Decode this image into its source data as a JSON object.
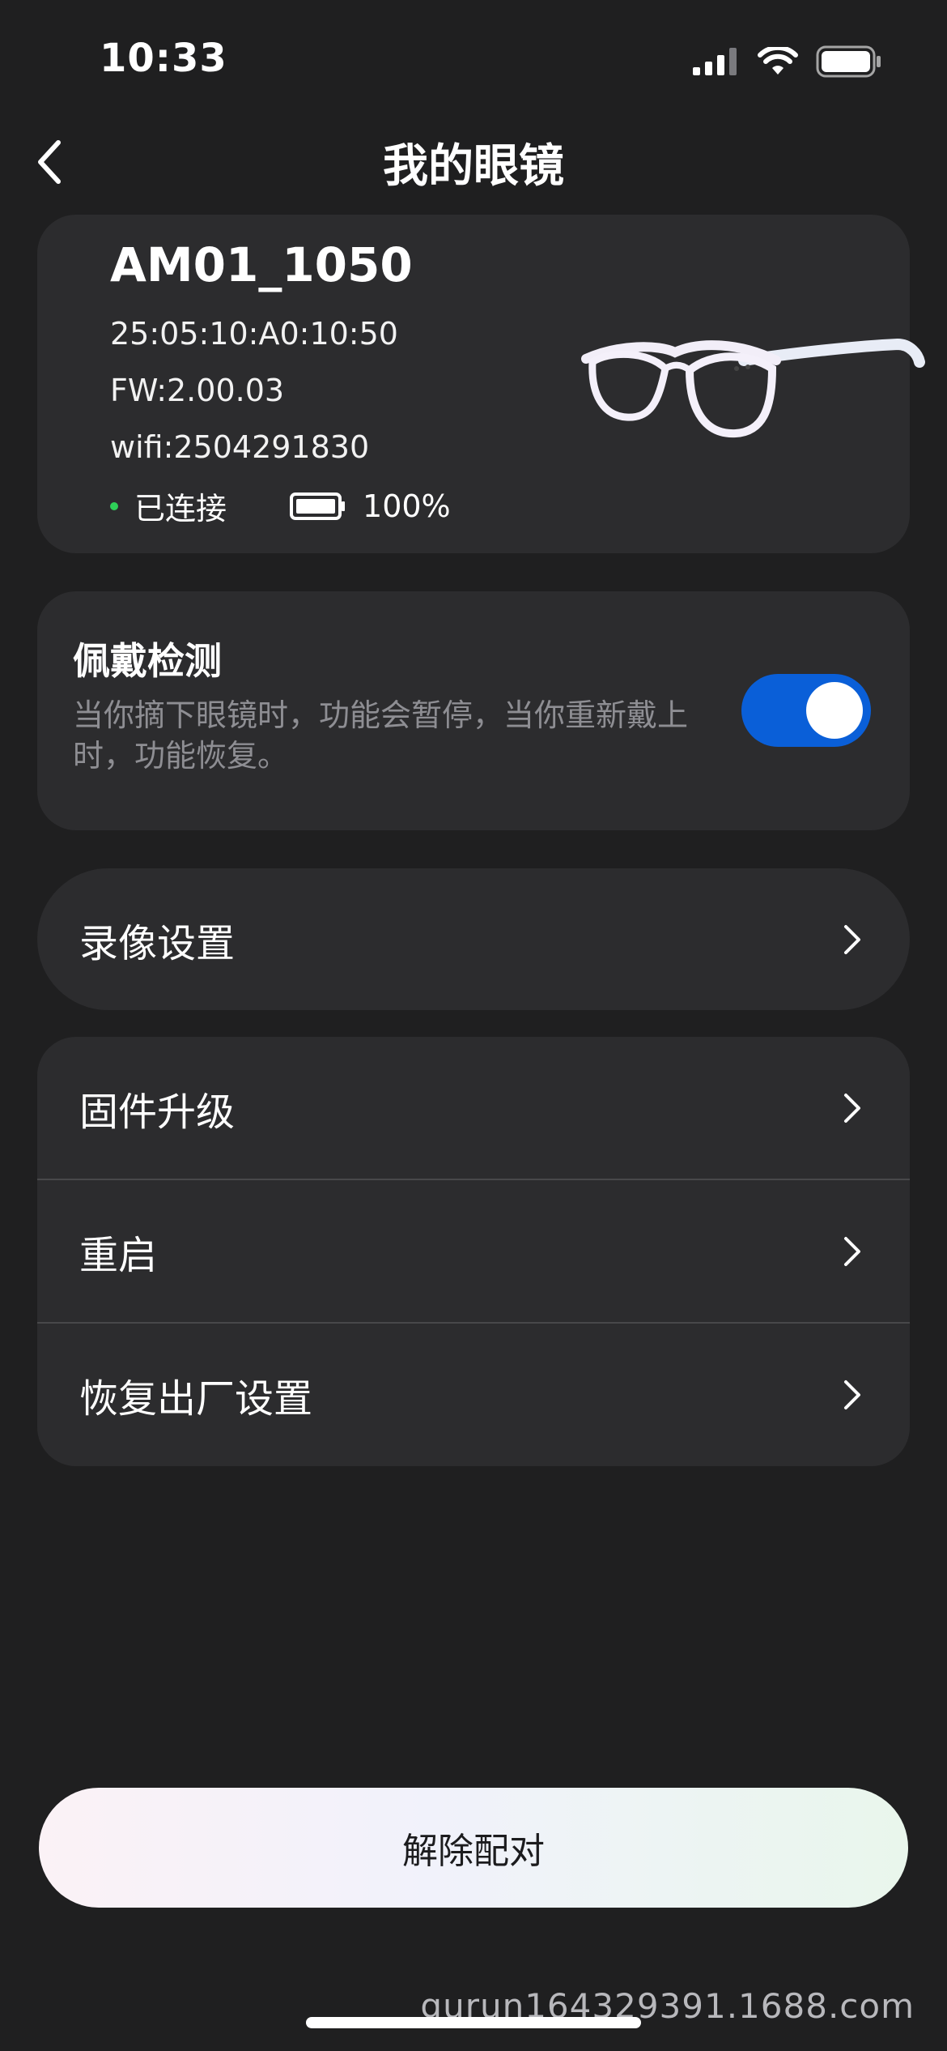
{
  "status_bar": {
    "time": "10:33",
    "icons": [
      "cellular-signal-icon",
      "wifi-icon",
      "battery-icon"
    ]
  },
  "nav": {
    "title": "我的眼镜",
    "back_icon": "chevron-left-icon"
  },
  "device": {
    "name": "AM01_1050",
    "mac": "25:05:10:A0:10:50",
    "firmware": "FW:2.00.03",
    "wifi": "wifi:2504291830",
    "connection_status": "已连接",
    "status_color": "#2ed158",
    "battery": "100%",
    "battery_level": 1.0,
    "image_icon": "glasses-icon"
  },
  "wear_detection": {
    "title": "佩戴检测",
    "description": "当你摘下眼镜时，功能会暂停，当你重新戴上时，功能恢复。",
    "enabled": true,
    "toggle_color": "#0a5fd8"
  },
  "menu": {
    "video_settings": "录像设置",
    "firmware_upgrade": "固件升级",
    "restart": "重启",
    "factory_reset": "恢复出厂设置"
  },
  "unpair_button": "解除配对",
  "watermark": "gurun164329391.1688.com"
}
